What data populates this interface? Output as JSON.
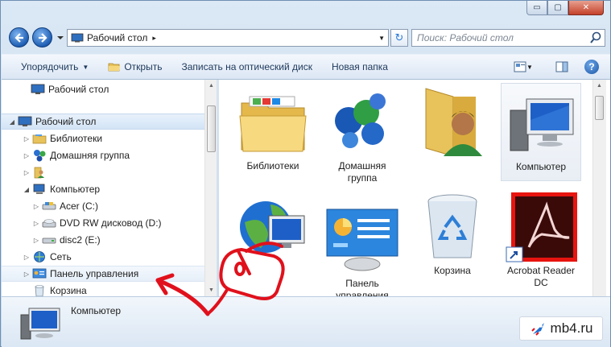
{
  "window": {
    "caption": {
      "minimize": "▭",
      "maximize": "▢",
      "close": "✕"
    }
  },
  "nav": {
    "back_icon": "back-arrow-icon",
    "forward_icon": "forward-arrow-icon",
    "address_crumb": "Рабочий стол",
    "address_sep": "▸",
    "address_dropdown": "▼",
    "refresh_icon": "↻",
    "search_placeholder": "Поиск: Рабочий стол"
  },
  "toolbar": {
    "organize": "Упорядочить",
    "open": "Открыть",
    "burn": "Записать на оптический диск",
    "new_folder": "Новая папка",
    "dd_arrow": "▼",
    "help": "?"
  },
  "navpane": {
    "favorites_desktop": "Рабочий стол",
    "tree": [
      {
        "label": "Рабочий стол",
        "exp": "◢"
      },
      {
        "label": "Библиотеки",
        "exp": "▷"
      },
      {
        "label": "Домашняя группа",
        "exp": "▷"
      },
      {
        "label": "",
        "exp": "▷"
      },
      {
        "label": "Компьютер",
        "exp": "◢"
      },
      {
        "label": "Acer (C:)",
        "exp": "▷"
      },
      {
        "label": "DVD RW дисковод (D:)",
        "exp": "▷"
      },
      {
        "label": "disc2 (E:)",
        "exp": "▷"
      },
      {
        "label": "Сеть",
        "exp": "▷"
      },
      {
        "label": "Панель управления",
        "exp": "▷"
      },
      {
        "label": "Корзина",
        "exp": ""
      }
    ],
    "scroll_up": "▲",
    "scroll_down": "▼"
  },
  "content": {
    "items": [
      {
        "label": "Библиотеки",
        "icon": "libraries-icon"
      },
      {
        "label": "Домашняя группа",
        "icon": "homegroup-icon"
      },
      {
        "label": "",
        "icon": "user-folder-icon"
      },
      {
        "label": "Компьютер",
        "icon": "computer-icon"
      },
      {
        "label": "",
        "icon": "network-icon"
      },
      {
        "label": "Панель управления",
        "icon": "control-panel-icon"
      },
      {
        "label": "Корзина",
        "icon": "recycle-bin-icon"
      },
      {
        "label": "Acrobat Reader DC",
        "icon": "acrobat-reader-icon"
      }
    ]
  },
  "details": {
    "name": "Компьютер"
  },
  "watermark": {
    "text": "mb4.ru"
  },
  "colors": {
    "accent": "#1f5fb4",
    "arrow": "#e0111c",
    "selection": "#d3e4f6"
  }
}
